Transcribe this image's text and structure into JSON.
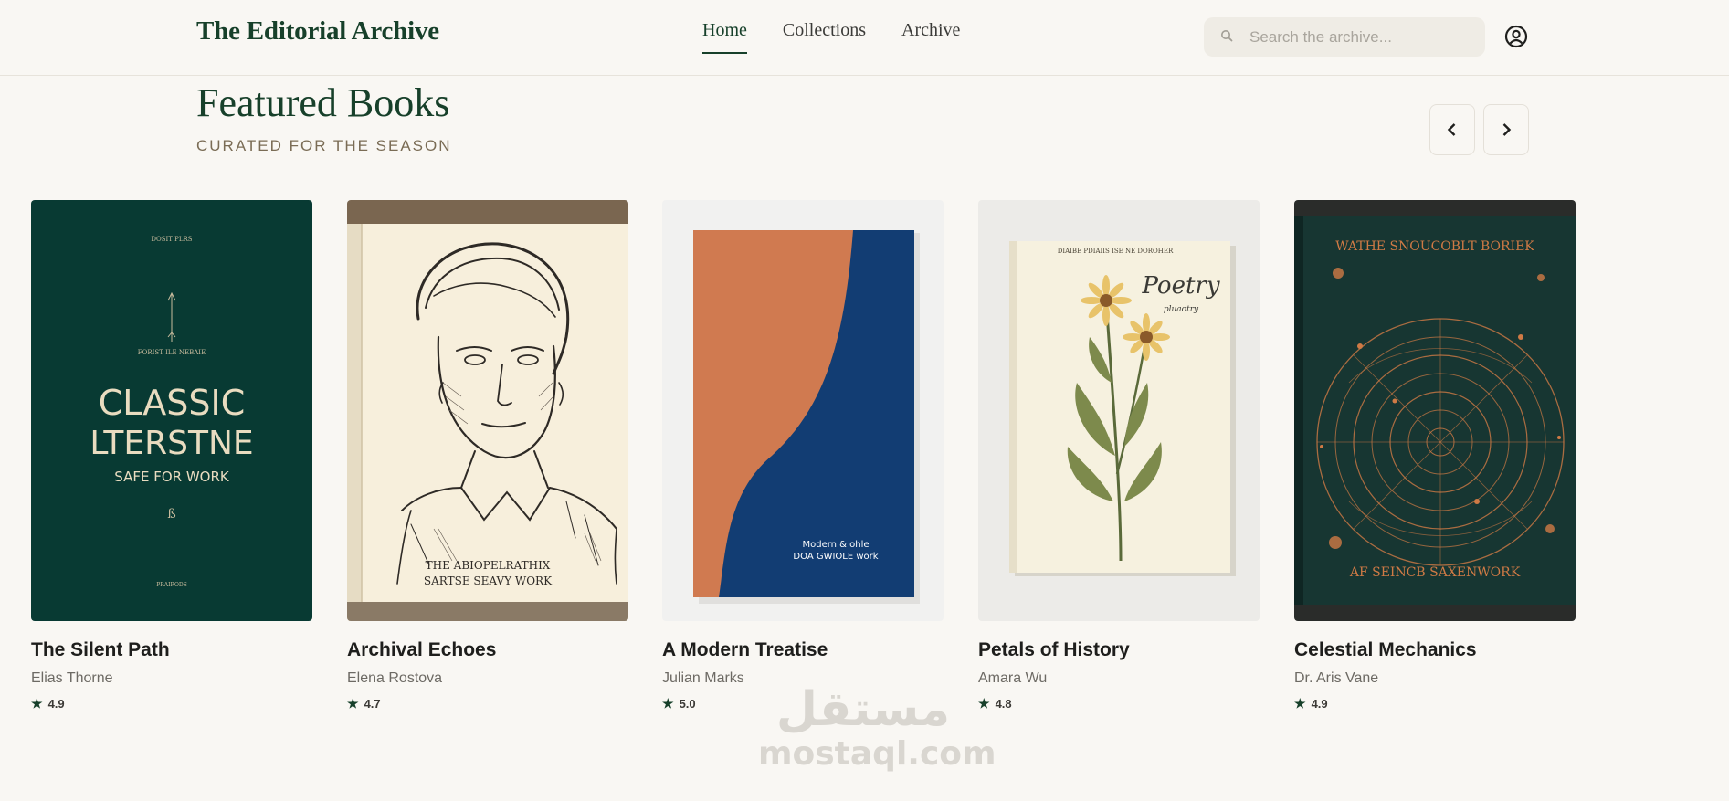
{
  "app": {
    "logo": "The Editorial Archive"
  },
  "nav": [
    {
      "label": "Home",
      "active": true
    },
    {
      "label": "Collections",
      "active": false
    },
    {
      "label": "Archive",
      "active": false
    }
  ],
  "search": {
    "placeholder": "Search the archive...",
    "value": ""
  },
  "icons": {
    "search": "search-icon",
    "account": "account-circle-icon",
    "prev": "chevron-left-icon",
    "next": "chevron-right-icon",
    "rating": "star-icon"
  },
  "section": {
    "title": "Featured Books",
    "subtitle": "CURATED FOR THE SEASON"
  },
  "books": [
    {
      "title": "The Silent Path",
      "author": "Elias Thorne",
      "rating": "4.9",
      "cover": {
        "line1": "CLASSIC",
        "line2": "LTERSTNE",
        "line3": "SAFE FOR WORK",
        "top_text": "DOSIT PLRS",
        "mid_text": "FORIST ILE NEBAIE",
        "bottom_text": "PRAIRODS",
        "glyph": "ß",
        "bg": "#083a33",
        "ink": "#e9dcc0"
      }
    },
    {
      "title": "Archival Echoes",
      "author": "Elena Rostova",
      "rating": "4.7",
      "cover": {
        "line1": "THE ABIOPELRATHIX",
        "line2": "SARTSE SEAVY WORK",
        "bg": "#7a6650",
        "paper": "#f7efdc"
      }
    },
    {
      "title": "A Modern Treatise",
      "author": "Julian Marks",
      "rating": "5.0",
      "cover": {
        "line1": "Modern & ohle",
        "line2": "DOA GWIOLE work",
        "orange": "#d07a50",
        "navy": "#123d73"
      }
    },
    {
      "title": "Petals of History",
      "author": "Amara Wu",
      "rating": "4.8",
      "cover": {
        "top_text": "DIAIBE PDIAIIS ISE NE DOROHER",
        "script": "Poetry",
        "script_sub": "pluaotry",
        "paper": "#f6f1df"
      }
    },
    {
      "title": "Celestial Mechanics",
      "author": "Dr. Aris Vane",
      "rating": "4.9",
      "cover": {
        "top_text": "WATHE SNOUCOBLT BORIEK",
        "bottom_text": "AF SEINCB SAXENWORK",
        "bg": "#173632",
        "ink": "#cf7a45"
      }
    }
  ],
  "watermark": {
    "arabic": "مستقل",
    "latin": "mostaql.com"
  },
  "colors": {
    "brand": "#17402a",
    "background": "#f9f7f3",
    "accent_muted": "#7a6c55"
  }
}
